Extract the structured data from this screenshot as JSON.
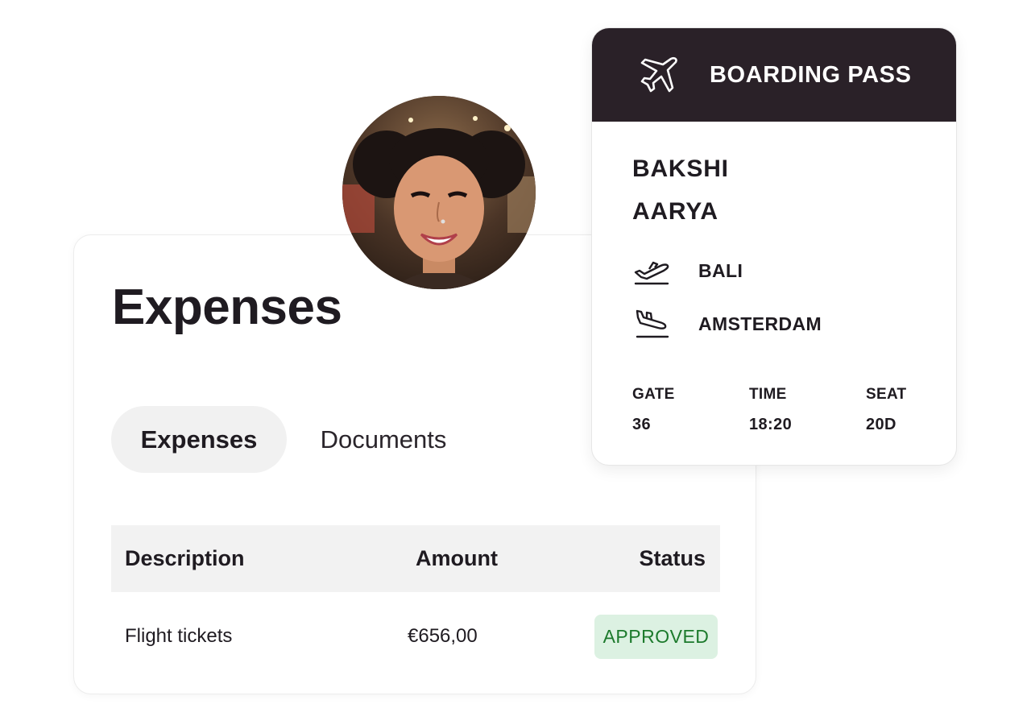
{
  "expenses": {
    "title": "Expenses",
    "tabs": [
      {
        "label": "Expenses",
        "active": true
      },
      {
        "label": "Documents",
        "active": false
      }
    ],
    "table": {
      "headers": {
        "description": "Description",
        "amount": "Amount",
        "status": "Status"
      },
      "rows": [
        {
          "description": "Flight tickets",
          "amount": "€656,00",
          "status": "APPROVED"
        }
      ]
    }
  },
  "avatar": {
    "icon": "avatar-photo"
  },
  "boarding_pass": {
    "title": "BOARDING PASS",
    "header_icon": "airplane-icon",
    "first_name": "BAKSHI",
    "last_name": "AARYA",
    "departure": {
      "icon": "takeoff-icon",
      "city": "BALI"
    },
    "arrival": {
      "icon": "landing-icon",
      "city": "AMSTERDAM"
    },
    "details": [
      {
        "label": "GATE",
        "value": "36"
      },
      {
        "label": "TIME",
        "value": "18:20"
      },
      {
        "label": "SEAT",
        "value": "20D"
      }
    ]
  },
  "colors": {
    "header_bg": "#2a2128",
    "approved_bg": "#dcf1e2",
    "approved_text": "#1c7a2c",
    "tab_active_bg": "#f1f1f1",
    "table_head_bg": "#f2f2f2"
  }
}
